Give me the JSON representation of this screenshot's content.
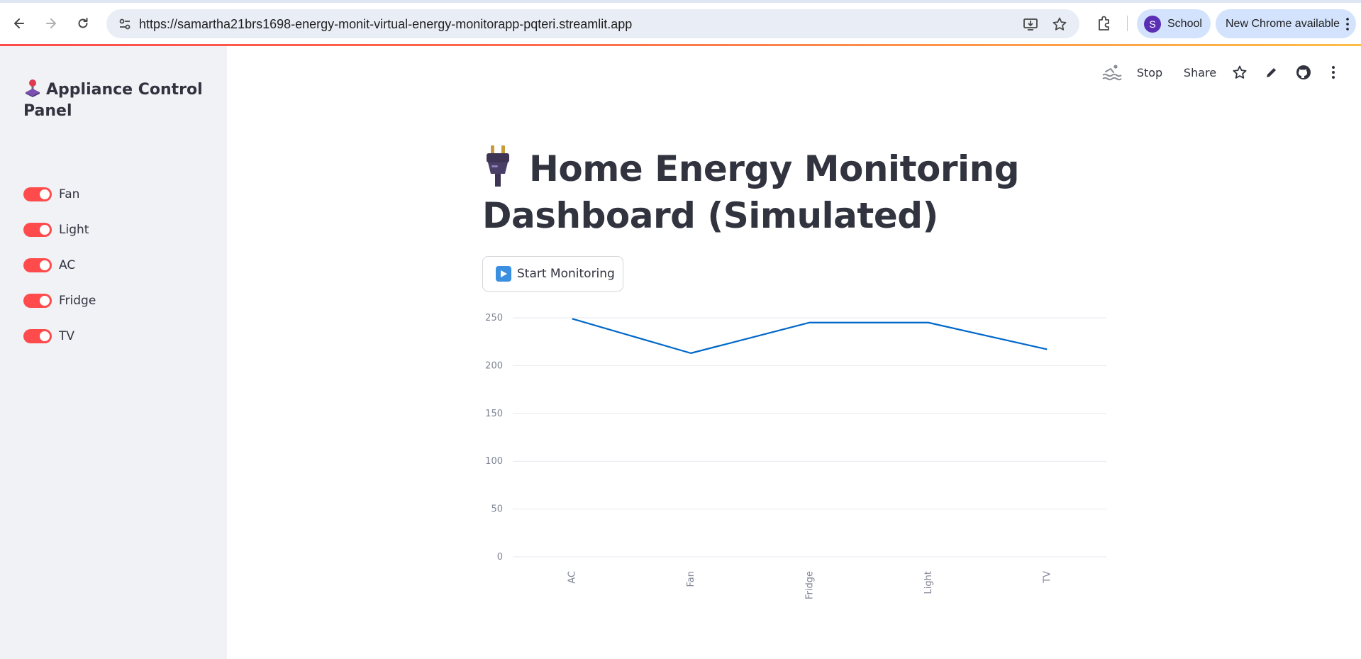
{
  "browser": {
    "url": "https://samartha21brs1698-energy-monit-virtual-energy-monitorapp-pqteri.streamlit.app",
    "profile": {
      "initial": "S",
      "name": "School"
    },
    "update_label": "New Chrome available"
  },
  "toolbar": {
    "stop_label": "Stop",
    "share_label": "Share"
  },
  "sidebar": {
    "title": "Appliance Control Panel",
    "toggles": [
      {
        "label": "Fan",
        "checked": true
      },
      {
        "label": "Light",
        "checked": true
      },
      {
        "label": "AC",
        "checked": true
      },
      {
        "label": "Fridge",
        "checked": true
      },
      {
        "label": "TV",
        "checked": true
      }
    ]
  },
  "main": {
    "title": "Home Energy Monitoring Dashboard (Simulated)",
    "start_button_label": "Start Monitoring"
  },
  "colors": {
    "accent": "#ff4b4b",
    "line": "#0068c9",
    "text": "#31333f"
  },
  "chart_data": {
    "type": "line",
    "categories": [
      "AC",
      "Fan",
      "Fridge",
      "Light",
      "TV"
    ],
    "values": [
      249,
      213,
      245,
      245,
      217
    ],
    "ylim": [
      0,
      250
    ],
    "yticks": [
      0,
      50,
      100,
      150,
      200,
      250
    ],
    "title": "",
    "xlabel": "",
    "ylabel": "",
    "grid": true
  }
}
